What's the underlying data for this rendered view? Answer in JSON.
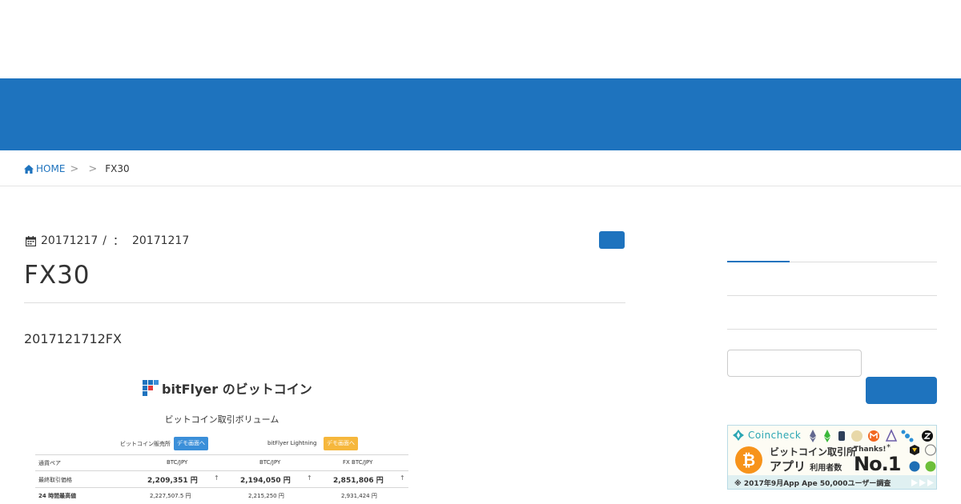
{
  "breadcrumb": {
    "home_label": "HOME",
    "separator": ">",
    "current": "FX30"
  },
  "post": {
    "date_published": "20171217",
    "meta_slash": "/",
    "meta_colon": "：",
    "date_updated": "20171217",
    "title": "FX30",
    "lead": "2017121712FX"
  },
  "screenshot": {
    "brand": "bitFlyer のビットコイン",
    "subtitle": "ビットコイン取引ボリューム",
    "label_shop": "ビットコイン販売所",
    "label_lightning": "bitFlyer Lightning",
    "demo_btn_1": "デモ画面へ",
    "demo_btn_2": "デモ画面へ",
    "col_pair": "通貨ペア",
    "col_1": "BTC/JPY",
    "col_2": "BTC/JPY",
    "col_3": "FX BTC/JPY",
    "row1_label": "最終取引価格",
    "row1_v1": "2,209,351 円",
    "row1_v2": "2,194,050 円",
    "row1_v3": "2,851,806 円",
    "row2_label": "24 時間最高値",
    "row2_v1": "2,227,507.5 円",
    "row2_v2": "2,215,250 円",
    "row2_v3": "2,931,424 円",
    "arrow": "↑"
  },
  "ad": {
    "brand": "Coincheck",
    "line1": "ビットコイン取引所",
    "line2_a": "アプリ",
    "line2_b": "利用者数",
    "thanks": "Thanks!",
    "no1": "No.1",
    "star": "*",
    "note": "※ 2017年9月App Ape 50,000ユーザー調査",
    "colors": {
      "teal": "#2aa6b3",
      "orange": "#f7931a"
    }
  },
  "colors": {
    "brand_blue": "#1e73be"
  }
}
